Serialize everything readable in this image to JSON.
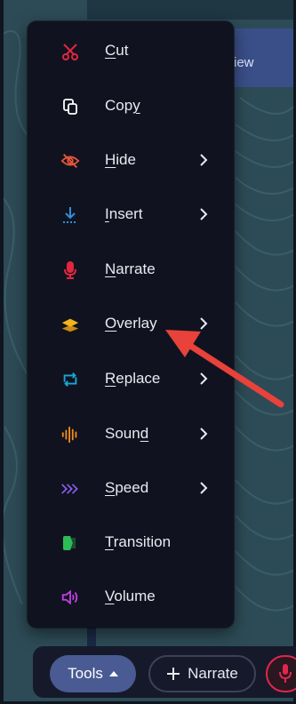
{
  "background": {
    "preview_tab_label": "iew"
  },
  "menu": {
    "items": [
      {
        "label": "Cut",
        "underline": "C",
        "rest": "ut",
        "icon": "scissors-icon",
        "color": "#e0263f",
        "submenu": false
      },
      {
        "label": "Copy",
        "underline": "y",
        "rest": "Cop",
        "icon": "copy-icon",
        "color": "#ffffff",
        "submenu": false
      },
      {
        "label": "Hide",
        "underline": "H",
        "rest": "ide",
        "icon": "eye-off-icon",
        "color": "#e8553a",
        "submenu": true
      },
      {
        "label": "Insert",
        "underline": "I",
        "rest": "nsert",
        "icon": "insert-icon",
        "color": "#2f8fe0",
        "submenu": true
      },
      {
        "label": "Narrate",
        "underline": "N",
        "rest": "arrate",
        "icon": "microphone-icon",
        "color": "#e0263f",
        "submenu": false
      },
      {
        "label": "Overlay",
        "underline": "O",
        "rest": "verlay",
        "icon": "layers-icon",
        "color": "#f2b51e",
        "submenu": true
      },
      {
        "label": "Replace",
        "underline": "R",
        "rest": "eplace",
        "icon": "replace-icon",
        "color": "#1aa7d8",
        "submenu": true
      },
      {
        "label": "Sound",
        "underline": "d",
        "rest": "Soun",
        "icon": "audio-wave-icon",
        "color": "#f08c1e",
        "submenu": true
      },
      {
        "label": "Speed",
        "underline": "S",
        "rest": "peed",
        "icon": "speed-icon",
        "color": "#8b5cf6",
        "submenu": true
      },
      {
        "label": "Transition",
        "underline": "T",
        "rest": "ransition",
        "icon": "transition-icon",
        "color": "#2dbb55",
        "submenu": false
      },
      {
        "label": "Volume",
        "underline": "V",
        "rest": "olume",
        "icon": "volume-icon",
        "color": "#c13fe0",
        "submenu": false
      }
    ]
  },
  "toolbar": {
    "tools_label": "Tools",
    "narrate_label": "Narrate",
    "accent": "#e1264d"
  },
  "annotation": {
    "arrow_color": "#e8423a"
  }
}
